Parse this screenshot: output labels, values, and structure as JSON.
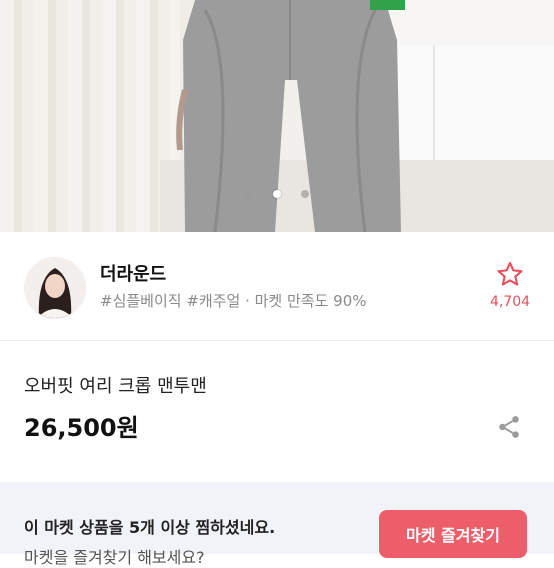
{
  "gallery": {
    "slide_count": 3,
    "active_index": 1
  },
  "shop": {
    "name": "더라운드",
    "tags": "#심플베이직 #캐주얼 · 마켓 만족도 90%",
    "favorite_count": "4,704",
    "favorite_icon": "star-outline-icon"
  },
  "product": {
    "name": "오버핏 여리 크롭 맨투맨",
    "price": "26,500원",
    "share_icon": "share-icon"
  },
  "banner": {
    "message": "이 마켓 상품을 5개 이상 찜하셨네요.",
    "sub_message": "마켓을 즐겨찾기 해보세요?",
    "button_label": "마켓 즐겨찾기"
  },
  "colors": {
    "accent": "#ec5f6a",
    "favorite_red": "#e8505b",
    "banner_bg": "#f1f3f8"
  }
}
